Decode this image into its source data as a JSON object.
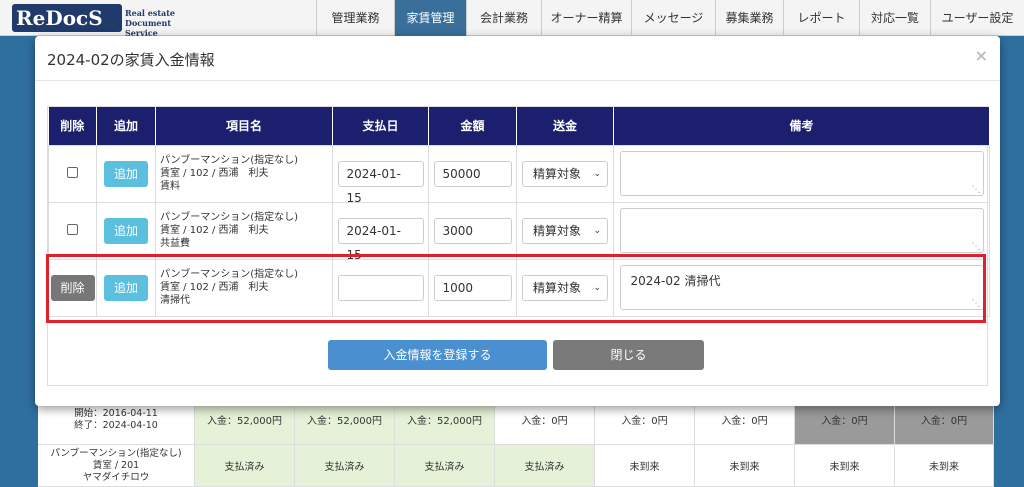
{
  "header": {
    "logo_main": "ReDocS",
    "logo_sub_1": "Real estate",
    "logo_sub_2": "Document Service",
    "nav": [
      {
        "label": "管理業務",
        "active": false
      },
      {
        "label": "家賃管理",
        "active": true
      },
      {
        "label": "会計業務",
        "active": false
      },
      {
        "label": "オーナー精算",
        "active": false
      },
      {
        "label": "メッセージ",
        "active": false
      },
      {
        "label": "募集業務",
        "active": false
      },
      {
        "label": "レポート",
        "active": false
      },
      {
        "label": "対応一覧",
        "active": false
      },
      {
        "label": "ユーザー設定",
        "active": false
      }
    ]
  },
  "modal": {
    "title": "2024-02の家賃入金情報",
    "close": "×",
    "columns": [
      "削除",
      "追加",
      "項目名",
      "支払日",
      "金額",
      "送金",
      "備考"
    ],
    "rows": [
      {
        "delete_type": "checkbox",
        "add_label": "追加",
        "item_line1": "パンブーマンション(指定なし)",
        "item_line2": "賃室 / 102 / 西浦　利夫",
        "item_line3": "賃料",
        "pay_date": "2024-01-15",
        "amount": "50000",
        "remit": "精算対象",
        "note": ""
      },
      {
        "delete_type": "checkbox",
        "add_label": "追加",
        "item_line1": "パンブーマンション(指定なし)",
        "item_line2": "賃室 / 102 / 西浦　利夫",
        "item_line3": "共益費",
        "pay_date": "2024-01-15",
        "amount": "3000",
        "remit": "精算対象",
        "note": ""
      },
      {
        "delete_type": "button",
        "delete_label": "削除",
        "add_label": "追加",
        "item_line1": "パンブーマンション(指定なし)",
        "item_line2": "賃室 / 102 / 西浦　利夫",
        "item_line3": "清掃代",
        "pay_date": "",
        "amount": "1000",
        "remit": "精算対象",
        "note": "2024-02 清掃代"
      }
    ],
    "submit_label": "入金情報を登録する",
    "close_label": "閉じる"
  },
  "background": {
    "row1": {
      "period_start": "開始：2016-04-11",
      "period_end": "終了：2024-04-10",
      "cells": [
        "入金：52,000円",
        "入金：52,000円",
        "入金：52,000円",
        "入金：0円",
        "入金：0円",
        "入金：0円",
        "入金：0円",
        "入金：0円"
      ]
    },
    "row2": {
      "name": "パンブーマンション(指定なし)",
      "unit": "賃室 / 201",
      "tenant": "ヤマダイチロウ",
      "cells": [
        "支払済み",
        "支払済み",
        "支払済み",
        "支払済み",
        "未到来",
        "未到来",
        "未到来",
        "未到来"
      ]
    }
  },
  "colors": {
    "header_navy": "#1b1f6e",
    "primary": "#4a90d0",
    "info": "#5bc0de",
    "highlight": "#e0202a"
  }
}
